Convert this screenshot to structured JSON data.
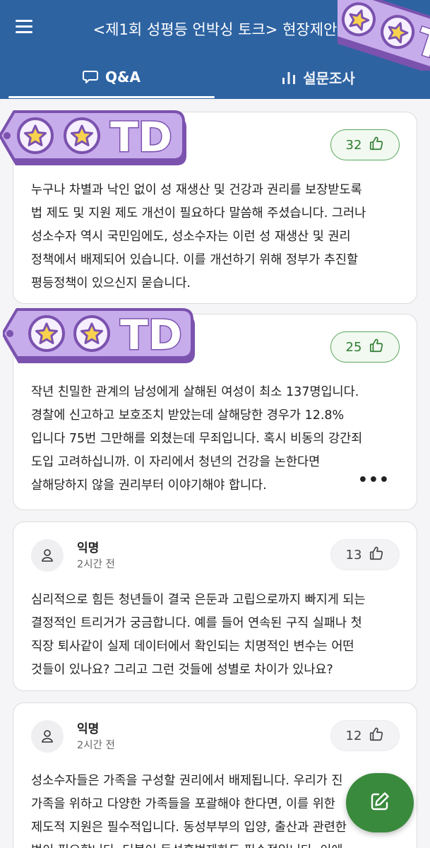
{
  "header": {
    "title": "<제1회 성평등 언박싱 토크> 현장제안",
    "menu_icon": "hamburger-menu-icon"
  },
  "tabs": [
    {
      "label": "Q&A",
      "icon": "chat-bubble-icon",
      "active": true
    },
    {
      "label": "설문조사",
      "icon": "bar-chart-icon",
      "active": false
    }
  ],
  "sticker_text": "TD",
  "colors": {
    "header": "#2e63a2",
    "accent_green": "#3a8a3d",
    "sticker_purple": "#a884d6"
  },
  "posts": [
    {
      "likes": "32",
      "text": [
        "누구나 차별과 낙인 없이 성 재생산 및 건강과 권리를 보장받도록",
        "법 제도 및 지원 제도 개선이 필요하다 말씀해 주셨습니다. 그러나",
        "성소수자 역시 국민임에도, 성소수자는 이런 성 재생산 및 권리",
        "정책에서 배제되어 있습니다. 이를 개선하기 위해 정부가 추진할",
        "평등정책이 있으신지 묻습니다."
      ]
    },
    {
      "likes": "25",
      "more": "•••",
      "text": [
        "작년 친밀한 관계의 남성에게 살해된 여성이 최소 137명입니다.",
        "경찰에 신고하고 보호조치 받았는데 살해당한 경우가 12.8%",
        "입니다 75번 그만해를 외쳤는데 무죄입니다. 혹시 비동의 강간죄",
        "도입 고려하십니까. 이 자리에서 청년의 건강을 논한다면",
        "살해당하지 않을 권리부터 이야기해야 합니다."
      ]
    },
    {
      "author": "익명",
      "time": "2시간 전",
      "likes": "13",
      "text": [
        "심리적으로 힘든 청년들이 결국 은둔과 고립으로까지 빠지게 되는",
        "결정적인 트리거가 궁금합니다. 예를 들어 연속된 구직 실패나 첫",
        "직장 퇴사같이 실제 데이터에서 확인되는 치명적인 변수는 어떤",
        "것들이 있나요? 그리고 그런 것들에 성별로 차이가 있나요?"
      ]
    },
    {
      "author": "익명",
      "time": "2시간 전",
      "likes": "12",
      "text": [
        "성소수자들은 가족을 구성할 권리에서 배제됩니다. 우리가 진",
        "가족을 위하고 다양한 가족들을 포괄해야 한다면, 이를 위한",
        "제도적 지원은 필수적입니다. 동성부부의 입양, 출산과 관련한",
        "법이 필요합니다. 더불어 동성혼법제화도 필수적입니다. 이에"
      ]
    }
  ],
  "fab_icon": "edit-pencil-icon"
}
